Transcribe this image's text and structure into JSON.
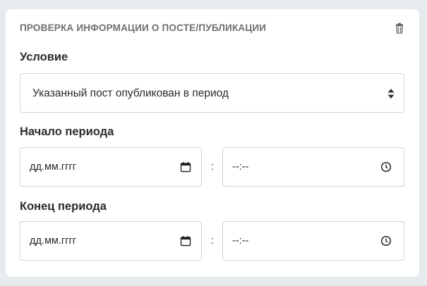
{
  "card": {
    "title": "ПРОВЕРКА ИНФОРМАЦИИ О ПОСТЕ/ПУБЛИКАЦИИ",
    "delete_icon": "trash-icon"
  },
  "condition": {
    "label": "Условие",
    "selected": "Указанный пост опубликован в период",
    "icon": "select-arrows-icon"
  },
  "period_start": {
    "label": "Начало периода",
    "date_placeholder": "дд.мм.гггг",
    "time_placeholder": "--:--",
    "separator": ":",
    "date_icon": "calendar-icon",
    "time_icon": "clock-icon"
  },
  "period_end": {
    "label": "Конец периода",
    "date_placeholder": "дд.мм.гггг",
    "time_placeholder": "--:--",
    "separator": ":",
    "date_icon": "calendar-icon",
    "time_icon": "clock-icon"
  },
  "colors": {
    "background": "#e6ecee",
    "card": "#ffffff",
    "border": "#cfd4d8",
    "text": "#2b2b2e",
    "muted": "#6e6e73"
  }
}
